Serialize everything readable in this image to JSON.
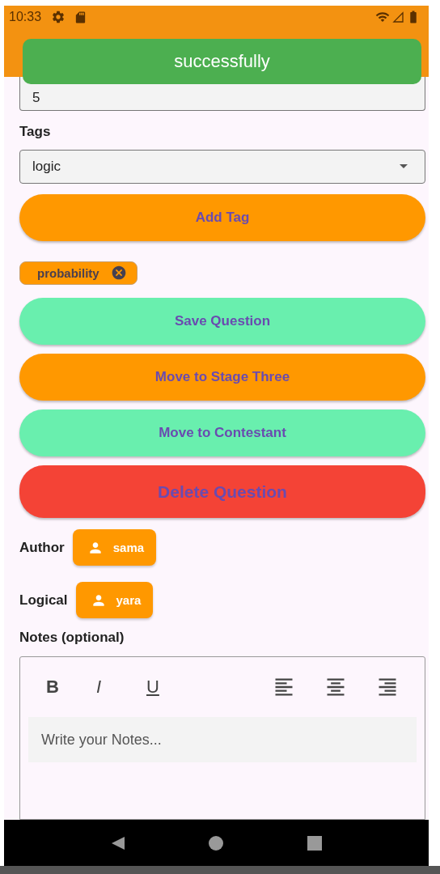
{
  "status_bar": {
    "time": "10:33"
  },
  "toast": {
    "message": "successfully"
  },
  "score_field": {
    "value": "5"
  },
  "tags": {
    "label": "Tags",
    "dropdown_value": "logic",
    "add_button": "Add Tag",
    "chips": [
      {
        "label": "probability"
      }
    ]
  },
  "actions": [
    {
      "label": "Save Question",
      "kind": "save"
    },
    {
      "label": "Move to Stage Three",
      "kind": "move"
    },
    {
      "label": "Move to Contestant",
      "kind": "save"
    },
    {
      "label": "Delete Question",
      "kind": "delete"
    }
  ],
  "people": [
    {
      "label": "Author",
      "name": "sama"
    },
    {
      "label": "Logical",
      "name": "yara"
    }
  ],
  "notes": {
    "label": "Notes (optional)",
    "toolbar": [
      "B",
      "I",
      "U"
    ],
    "placeholder": "Write your Notes..."
  }
}
